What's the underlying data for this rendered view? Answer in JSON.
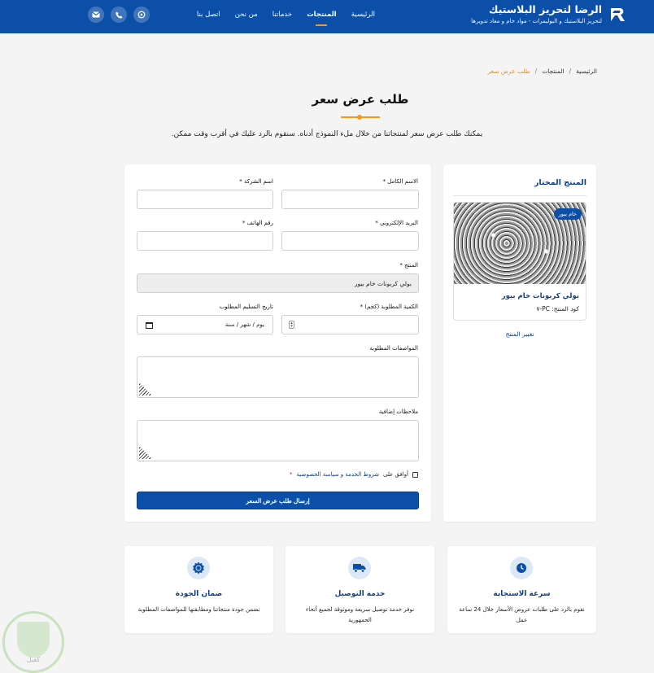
{
  "header": {
    "brand_title": "الرضا لتحريز البلاستيك",
    "brand_subtitle": "لتحريز البلاستيك و البوليمرات - مواد خام و معاد تدويرها",
    "nav": [
      {
        "label": "الرئيسية",
        "active": false
      },
      {
        "label": "المنتجات",
        "active": true
      },
      {
        "label": "خدماتنا",
        "active": false
      },
      {
        "label": "من نحن",
        "active": false
      },
      {
        "label": "اتصل بنا",
        "active": false
      }
    ],
    "social_icons": [
      "whatsapp-icon",
      "phone-icon",
      "envelope-icon"
    ],
    "accent": "#f39a1e",
    "bg": "#0b4fa8"
  },
  "breadcrumb": {
    "home": "الرئيسية",
    "products": "المنتجات",
    "current": "طلب عرض سعر"
  },
  "page": {
    "title": "طلب عرض سعر",
    "intro": "يمكنك طلب عرض سعر لمنتجاتنا من خلال ملء النموذج أدناه. سنقوم بالرد عليك في أقرب وقت ممكن."
  },
  "sidebar": {
    "title": "المنتج المختار",
    "badge": "خام بيور",
    "product_name": "بولي كربونات خام بيور",
    "product_code": "كود المنتج: PC-٧",
    "change_link": "تغيير المنتج"
  },
  "form": {
    "full_name_label": "الاسم الكامل *",
    "company_label": "اسم الشركة *",
    "email_label": "البريد الإلكتروني *",
    "phone_label": "رقم الهاتف *",
    "product_label": "المنتج *",
    "product_value": "بولي كربونات خام بيور",
    "quantity_label": "الكمية المطلوبة (كجم) *",
    "delivery_label": "تاريخ التسليم المطلوب",
    "date_placeholder": "يوم / شهر / سنة",
    "specs_label": "المواصفات المطلوبة",
    "notes_label": "ملاحظات إضافية",
    "terms_prefix": "أوافق على",
    "terms_link": "شروط الخدمة و سياسة الخصوصية",
    "terms_star": "*",
    "submit_label": "إرسال طلب عرض السعر"
  },
  "features": [
    {
      "icon": "clock-icon",
      "title": "سرعة الاستجابة",
      "desc": "نقوم بالرد على طلبات عروض الأسعار خلال 24 ساعة عمل"
    },
    {
      "icon": "truck-icon",
      "title": "خدمة التوصيل",
      "desc": "نوفر خدمة توصيل سريعة وموثوقة لجميع أنحاء الجمهورية"
    },
    {
      "icon": "certificate-icon",
      "title": "ضمان الجودة",
      "desc": "نضمن جودة منتجاتنا ومطابقتها للمواصفات المطلوبة"
    }
  ],
  "watermark_text": "كفيل"
}
